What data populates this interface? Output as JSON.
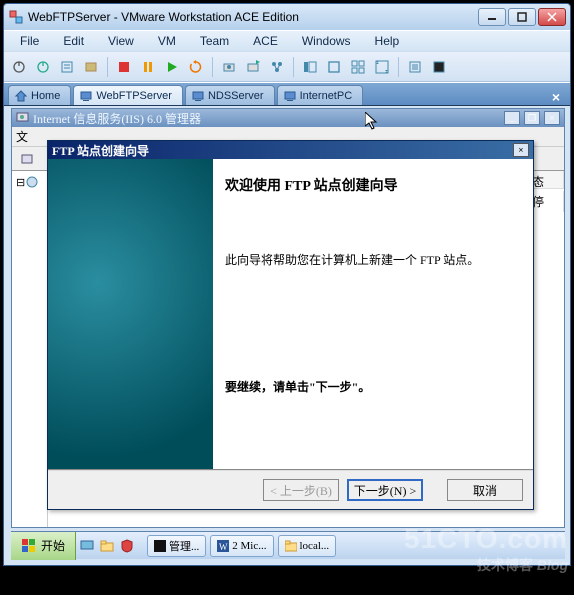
{
  "vmware": {
    "title": "WebFTPServer - VMware Workstation ACE Edition",
    "menu": [
      "File",
      "Edit",
      "View",
      "VM",
      "Team",
      "ACE",
      "Windows",
      "Help"
    ],
    "tabs": [
      {
        "label": "Home",
        "icon": "home-icon"
      },
      {
        "label": "WebFTPServer",
        "icon": "vm-icon"
      },
      {
        "label": "NDSServer",
        "icon": "vm-icon"
      },
      {
        "label": "InternetPC",
        "icon": "vm-icon"
      }
    ]
  },
  "iis": {
    "title": "Internet 信息服务(IIS) 6.0 管理器",
    "menu_first": "文",
    "columns": {
      "status": "状态"
    },
    "row_status": "已停"
  },
  "wizard": {
    "title": "FTP 站点创建向导",
    "heading": "欢迎使用 FTP 站点创建向导",
    "description": "此向导将帮助您在计算机上新建一个 FTP 站点。",
    "continue": "要继续，请单击\"下一步\"。",
    "buttons": {
      "back": "< 上一步(B)",
      "next": "下一步(N) >",
      "cancel": "取消"
    }
  },
  "taskbar": {
    "start": "开始",
    "items": [
      {
        "label": "管理..."
      },
      {
        "label": "2 Mic..."
      },
      {
        "label": "local..."
      }
    ]
  },
  "watermark": {
    "domain": "51CTO.com",
    "sub": "技术博客",
    "tag": "Blog"
  }
}
